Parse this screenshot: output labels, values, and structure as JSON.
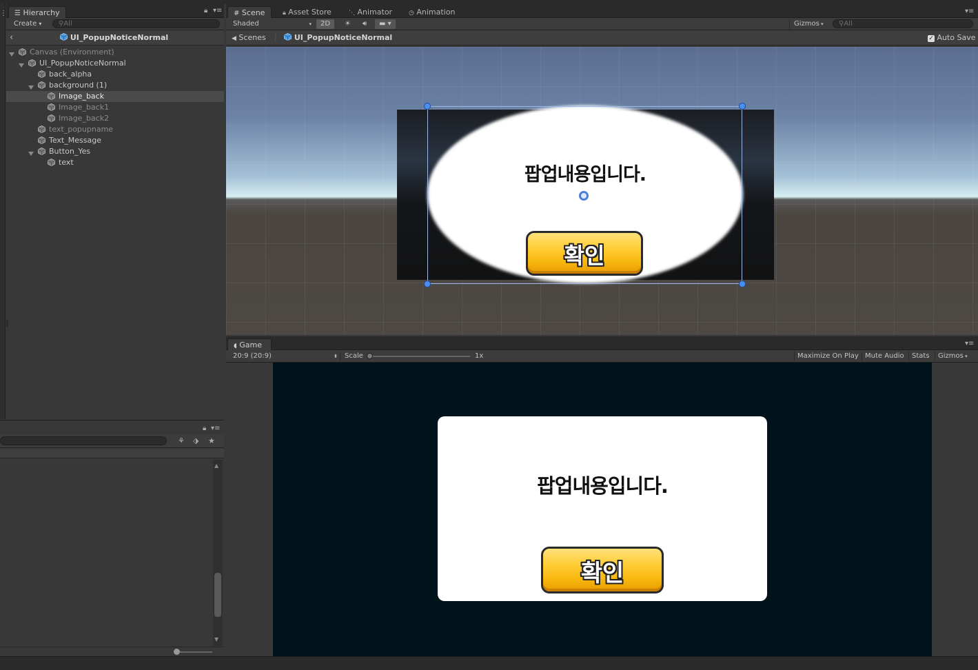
{
  "hierarchy": {
    "tab_label": "Hierarchy",
    "create_label": "Create",
    "search_placeholder": "All",
    "prefab_title": "UI_PopupNoticeNormal",
    "items": [
      {
        "label": "Canvas (Environment)",
        "depth": 0,
        "expanded": true,
        "dim": true,
        "selected": false
      },
      {
        "label": "UI_PopupNoticeNormal",
        "depth": 1,
        "expanded": true,
        "dim": false,
        "selected": false
      },
      {
        "label": "back_alpha",
        "depth": 2,
        "expanded": null,
        "dim": false,
        "selected": false
      },
      {
        "label": "background (1)",
        "depth": 2,
        "expanded": true,
        "dim": false,
        "selected": false
      },
      {
        "label": "Image_back",
        "depth": 3,
        "expanded": null,
        "dim": false,
        "selected": true
      },
      {
        "label": "Image_back1",
        "depth": 3,
        "expanded": null,
        "dim": true,
        "selected": false
      },
      {
        "label": "Image_back2",
        "depth": 3,
        "expanded": null,
        "dim": true,
        "selected": false
      },
      {
        "label": "text_popupname",
        "depth": 2,
        "expanded": null,
        "dim": true,
        "selected": false
      },
      {
        "label": "Text_Message",
        "depth": 2,
        "expanded": null,
        "dim": false,
        "selected": false
      },
      {
        "label": "Button_Yes",
        "depth": 2,
        "expanded": true,
        "dim": false,
        "selected": false
      },
      {
        "label": "text",
        "depth": 3,
        "expanded": null,
        "dim": false,
        "selected": false
      }
    ]
  },
  "scene": {
    "tabs": [
      {
        "label": "Scene",
        "icon": "grid-icon",
        "active": true
      },
      {
        "label": "Asset Store",
        "icon": "lock-icon",
        "active": false
      },
      {
        "label": "Animator",
        "icon": "animator-icon",
        "active": false
      },
      {
        "label": "Animation",
        "icon": "clock-icon",
        "active": false
      }
    ],
    "shading_mode": "Shaded",
    "mode_2d_label": "2D",
    "gizmos_label": "Gizmos",
    "search_placeholder": "All",
    "breadcrumb_scenes": "Scenes",
    "breadcrumb_prefab": "UI_PopupNoticeNormal",
    "auto_save_label": "Auto Save",
    "auto_save_checked": true,
    "popup_message": "팝업내용입니다.",
    "button_label": "확인"
  },
  "game": {
    "tab_label": "Game",
    "aspect_label": "20:9 (20:9)",
    "scale_label": "Scale",
    "scale_value": "1x",
    "buttons": [
      "Maximize On Play",
      "Mute Audio",
      "Stats",
      "Gizmos"
    ],
    "popup_message": "팝업내용입니다.",
    "button_label": "확인"
  },
  "colors": {
    "editor_bg": "#383838",
    "selection": "#4a4a4a",
    "button_yellow": "#ffcf3a",
    "game_bg": "#01131a",
    "gizmo_blue": "#4a8ff0"
  }
}
